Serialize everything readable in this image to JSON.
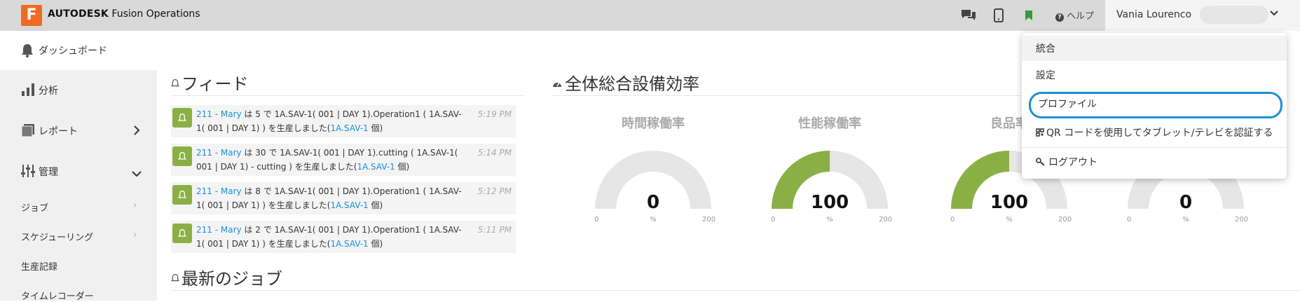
{
  "app": {
    "logo_letter": "F",
    "brand_bold": "AUTODESK",
    "brand_rest": " Fusion Operations",
    "brand_color": "#f26a21"
  },
  "topbar": {
    "icons": [
      "chat-icon",
      "mobile-icon",
      "bookmark-icon"
    ],
    "help_label": "ヘルプ",
    "user_name": "Vania Lourenco"
  },
  "sidebar": {
    "dashboard_label": "ダッシュボード",
    "items": [
      {
        "label": "分析",
        "icon": "bar-chart-icon"
      },
      {
        "label": "レポート",
        "icon": "report-icon"
      },
      {
        "label": "管理",
        "icon": "sliders-icon"
      }
    ],
    "sub_items": [
      {
        "label": "ジョブ"
      },
      {
        "label": "スケジューリング"
      },
      {
        "label": "生産記録"
      },
      {
        "label": "タイムレコーダー"
      }
    ]
  },
  "feed": {
    "title": "フィード",
    "items": [
      {
        "user": "211 - Mary",
        "line1": " は 5 で 1A.SAV-1( 001 | DAY 1).Operation1 ( 1A.SAV-",
        "line2": "1( 001 | DAY 1) ) を生産しました(",
        "part": "1A.SAV-1",
        "suffix": " 個)",
        "time": "5:19 PM"
      },
      {
        "user": "211 - Mary",
        "line1": " は 30 で 1A.SAV-1( 001 | DAY 1).cutting ( 1A.SAV-1(",
        "line2": "001 | DAY 1) - cutting ) を生産しました(",
        "part": "1A.SAV-1",
        "suffix": " 個)",
        "time": "5:14 PM"
      },
      {
        "user": "211 - Mary",
        "line1": " は 8 で 1A.SAV-1( 001 | DAY 1).Operation1 ( 1A.SAV-",
        "line2": "1( 001 | DAY 1) ) を生産しました(",
        "part": "1A.SAV-1",
        "suffix": " 個)",
        "time": "5:12 PM"
      },
      {
        "user": "211 - Mary",
        "line1": " は 2 で 1A.SAV-1( 001 | DAY 1).Operation1 ( 1A.SAV-",
        "line2": "1( 001 | DAY 1) ) を生産しました(",
        "part": "1A.SAV-1",
        "suffix": " 個)",
        "time": "5:11 PM"
      }
    ]
  },
  "latest_jobs": {
    "title": "最新のジョブ"
  },
  "oee": {
    "title": "全体総合設備効率",
    "gauges": [
      {
        "label": "時間稼働率",
        "value": "0",
        "fill_fraction": 0.0
      },
      {
        "label": "性能稼働率",
        "value": "100",
        "fill_fraction": 0.5
      },
      {
        "label": "良品率",
        "value": "100",
        "fill_fraction": 0.5
      },
      {
        "label": "",
        "value": "0",
        "fill_fraction": 0.0
      }
    ],
    "min": "0",
    "max": "200",
    "unit": "%",
    "fill_color": "#8ab045",
    "track_color": "#e6e6e6"
  },
  "user_menu": {
    "items": [
      {
        "label": "統合"
      },
      {
        "label": "設定"
      },
      {
        "label": "プロファイル"
      },
      {
        "label": "QR コードを使用してタブレット/テレビを認証する",
        "icon": "qr-icon"
      },
      {
        "label": "ログアウト",
        "icon": "key-icon"
      }
    ],
    "focus_color": "#1a8fd6"
  }
}
